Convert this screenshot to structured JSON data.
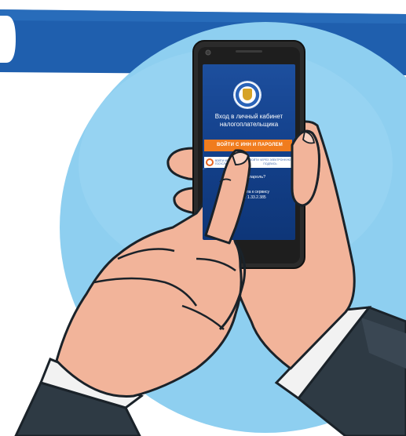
{
  "screen": {
    "title": "Вход в личный кабинет налогоплательщика",
    "login_button": "ВОЙТИ С ИНН И ПАРОЛЕМ",
    "alt_left_label": "ВОЙТИ ЧЕРЕЗ ГОСУСЛУГИ (ЕСИА)",
    "alt_right_label": "ВОЙТИ ЧЕРЕЗ ЭЛЕКТРОННУЮ ПОДПИСЬ",
    "forgot_label": "Забыли пароль?",
    "no_access_label": "Нет доступа к сервису",
    "version_label": "Версия: 1.33.2.385"
  },
  "colors": {
    "circle": "#8ecff0",
    "banner": "#1f5fae",
    "screen_blue": "#1d4f9e",
    "accent_orange": "#f07c1e",
    "phone_body": "#2b2b2b",
    "skin": "#f2b49a",
    "sleeve": "#2e3a44"
  },
  "icons": {
    "emblem": "fns-emblem-icon",
    "gosuslugi": "gosuslugi-icon",
    "camera": "camera-icon"
  }
}
